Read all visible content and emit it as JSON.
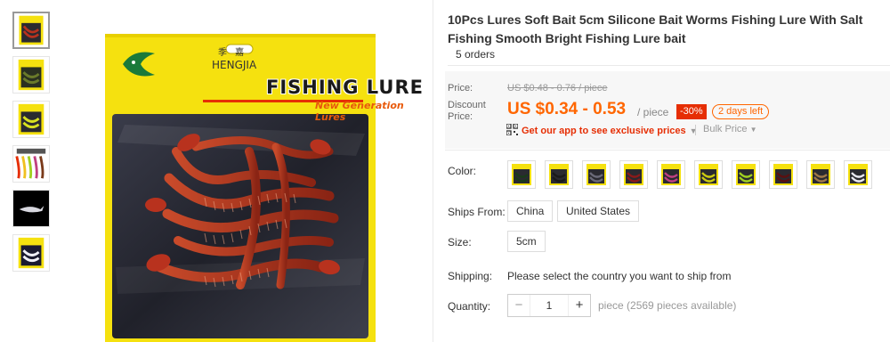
{
  "product": {
    "title": "10Pcs Lures Soft Bait 5cm Silicone Bait Worms Fishing Lure With Salt Fishing Smooth Bright Fishing Lure bait",
    "orders": "5 orders"
  },
  "gallery": {
    "package": {
      "brand_cn": "季 嘉",
      "brand_en": "HENGJIA",
      "title": "FISHING LURE",
      "subtitle": "New Generation Lures"
    },
    "thumbnails": [
      "thumb-1",
      "thumb-2",
      "thumb-3",
      "thumb-4",
      "thumb-5",
      "thumb-6"
    ]
  },
  "price": {
    "label": "Price:",
    "original": "US $0.48 - 0.76 / piece",
    "discount_label": "Discount Price:",
    "discount_label_line1": "Discount",
    "discount_label_line2": "Price:",
    "discount": "US $0.34 - 0.53",
    "unit": "/ piece",
    "percent_off": "-30%",
    "days_left": "2 days left",
    "app_promo": "Get our app to see exclusive prices",
    "bulk_price": "Bulk Price"
  },
  "options": {
    "color_label": "Color:",
    "color_swatches": [
      "#1a3a1a",
      "#1a1a1a",
      "#6a6a78",
      "#8a1a1a",
      "#c04080",
      "#cccc10",
      "#a0d020",
      "#5a1010",
      "#a07848",
      "#e8e8f0"
    ],
    "ships_from_label": "Ships From:",
    "ships_from": [
      "China",
      "United States"
    ],
    "size_label": "Size:",
    "sizes": [
      "5cm"
    ],
    "shipping_label": "Shipping:",
    "shipping_text": "Please select the country you want to ship from",
    "quantity_label": "Quantity:",
    "quantity": "1",
    "minus": "−",
    "plus": "+",
    "availability": "piece (2569 pieces available)"
  },
  "colors": {
    "accent": "#ff6600",
    "badge_red": "#e62e04",
    "package_yellow": "#f5e10f"
  }
}
